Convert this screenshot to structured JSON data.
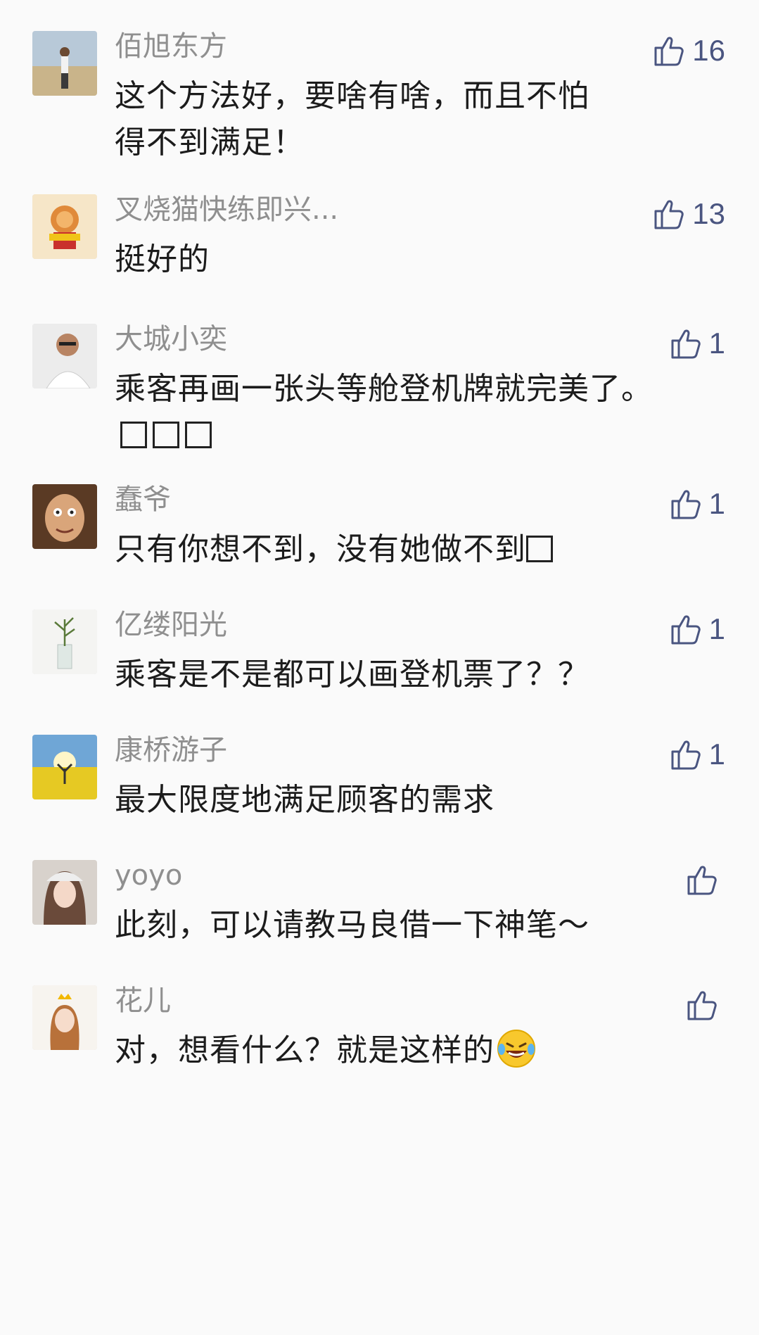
{
  "comments": [
    {
      "user": "佰旭东方",
      "text": "这个方法好，要啥有啥，而且不怕得不到满足！",
      "likes": "16"
    },
    {
      "user": "叉烧猫快练即兴...",
      "text": "挺好的",
      "likes": "13"
    },
    {
      "user": "大城小奕",
      "text": "乘客再画一张头等舱登机牌就完美了。",
      "likes": "1"
    },
    {
      "user": "蠢爷",
      "text": "只有你想不到，没有她做不到",
      "likes": "1"
    },
    {
      "user": "亿缕阳光",
      "text": "乘客是不是都可以画登机票了？？",
      "likes": "1"
    },
    {
      "user": "康桥游子",
      "text": "最大限度地满足顾客的需求",
      "likes": "1"
    },
    {
      "user": "yoyo",
      "text": "此刻，可以请教马良借一下神笔～",
      "likes": ""
    },
    {
      "user": "花儿",
      "text": "对，想看什么？就是这样的",
      "likes": ""
    }
  ],
  "colors": {
    "background": "#fafafa",
    "username": "#8f8f8f",
    "text": "#1c1c1c",
    "like": "#4a5580"
  },
  "icons": {
    "like": "thumbs-up-icon",
    "emoji": "laughing-tears-emoji-icon"
  }
}
